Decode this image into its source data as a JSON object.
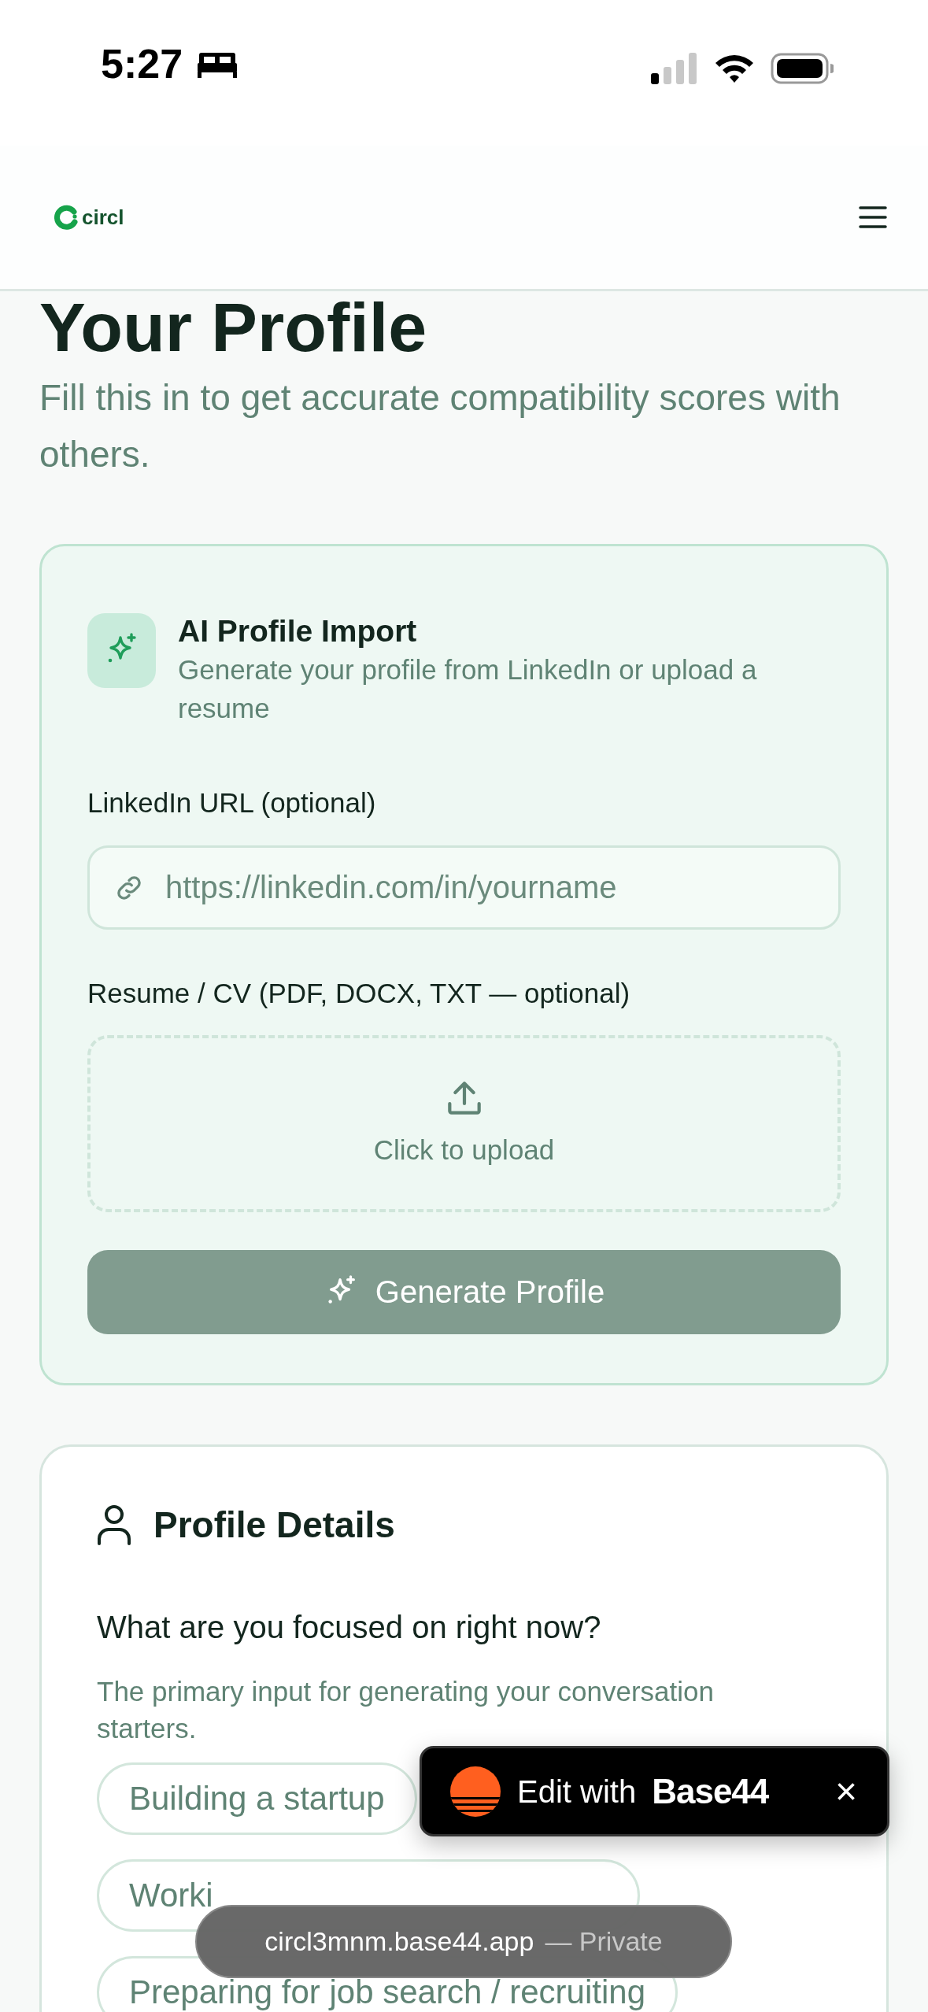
{
  "status_bar": {
    "time": "5:27"
  },
  "header": {
    "logo_text": "circl"
  },
  "page": {
    "title": "Your Profile",
    "subtitle": "Fill this in to get accurate compatibility scores with others."
  },
  "ai_import": {
    "title": "AI Profile Import",
    "description": "Generate your profile from LinkedIn or upload a resume",
    "linkedin_label": "LinkedIn URL (optional)",
    "linkedin_placeholder": "https://linkedin.com/in/yourname",
    "resume_label": "Resume / CV (PDF, DOCX, TXT — optional)",
    "upload_text": "Click to upload",
    "button": {
      "label": "Generate Profile",
      "disabled": true
    }
  },
  "profile_details": {
    "title": "Profile Details",
    "question": "What are you focused on right now?",
    "help": "The primary input for generating your conversation starters.",
    "options": [
      {
        "label": "Building a startup",
        "selected": false
      },
      {
        "label": "Worki",
        "selected": false
      },
      {
        "label": "Preparing for job search / recruiting",
        "selected": false
      }
    ]
  },
  "editor_badge": {
    "text": "Edit with",
    "brand": "Base44",
    "close": "×"
  },
  "address_toast": {
    "host": "circl3mnm.base44.app",
    "suffix": "— Private"
  }
}
